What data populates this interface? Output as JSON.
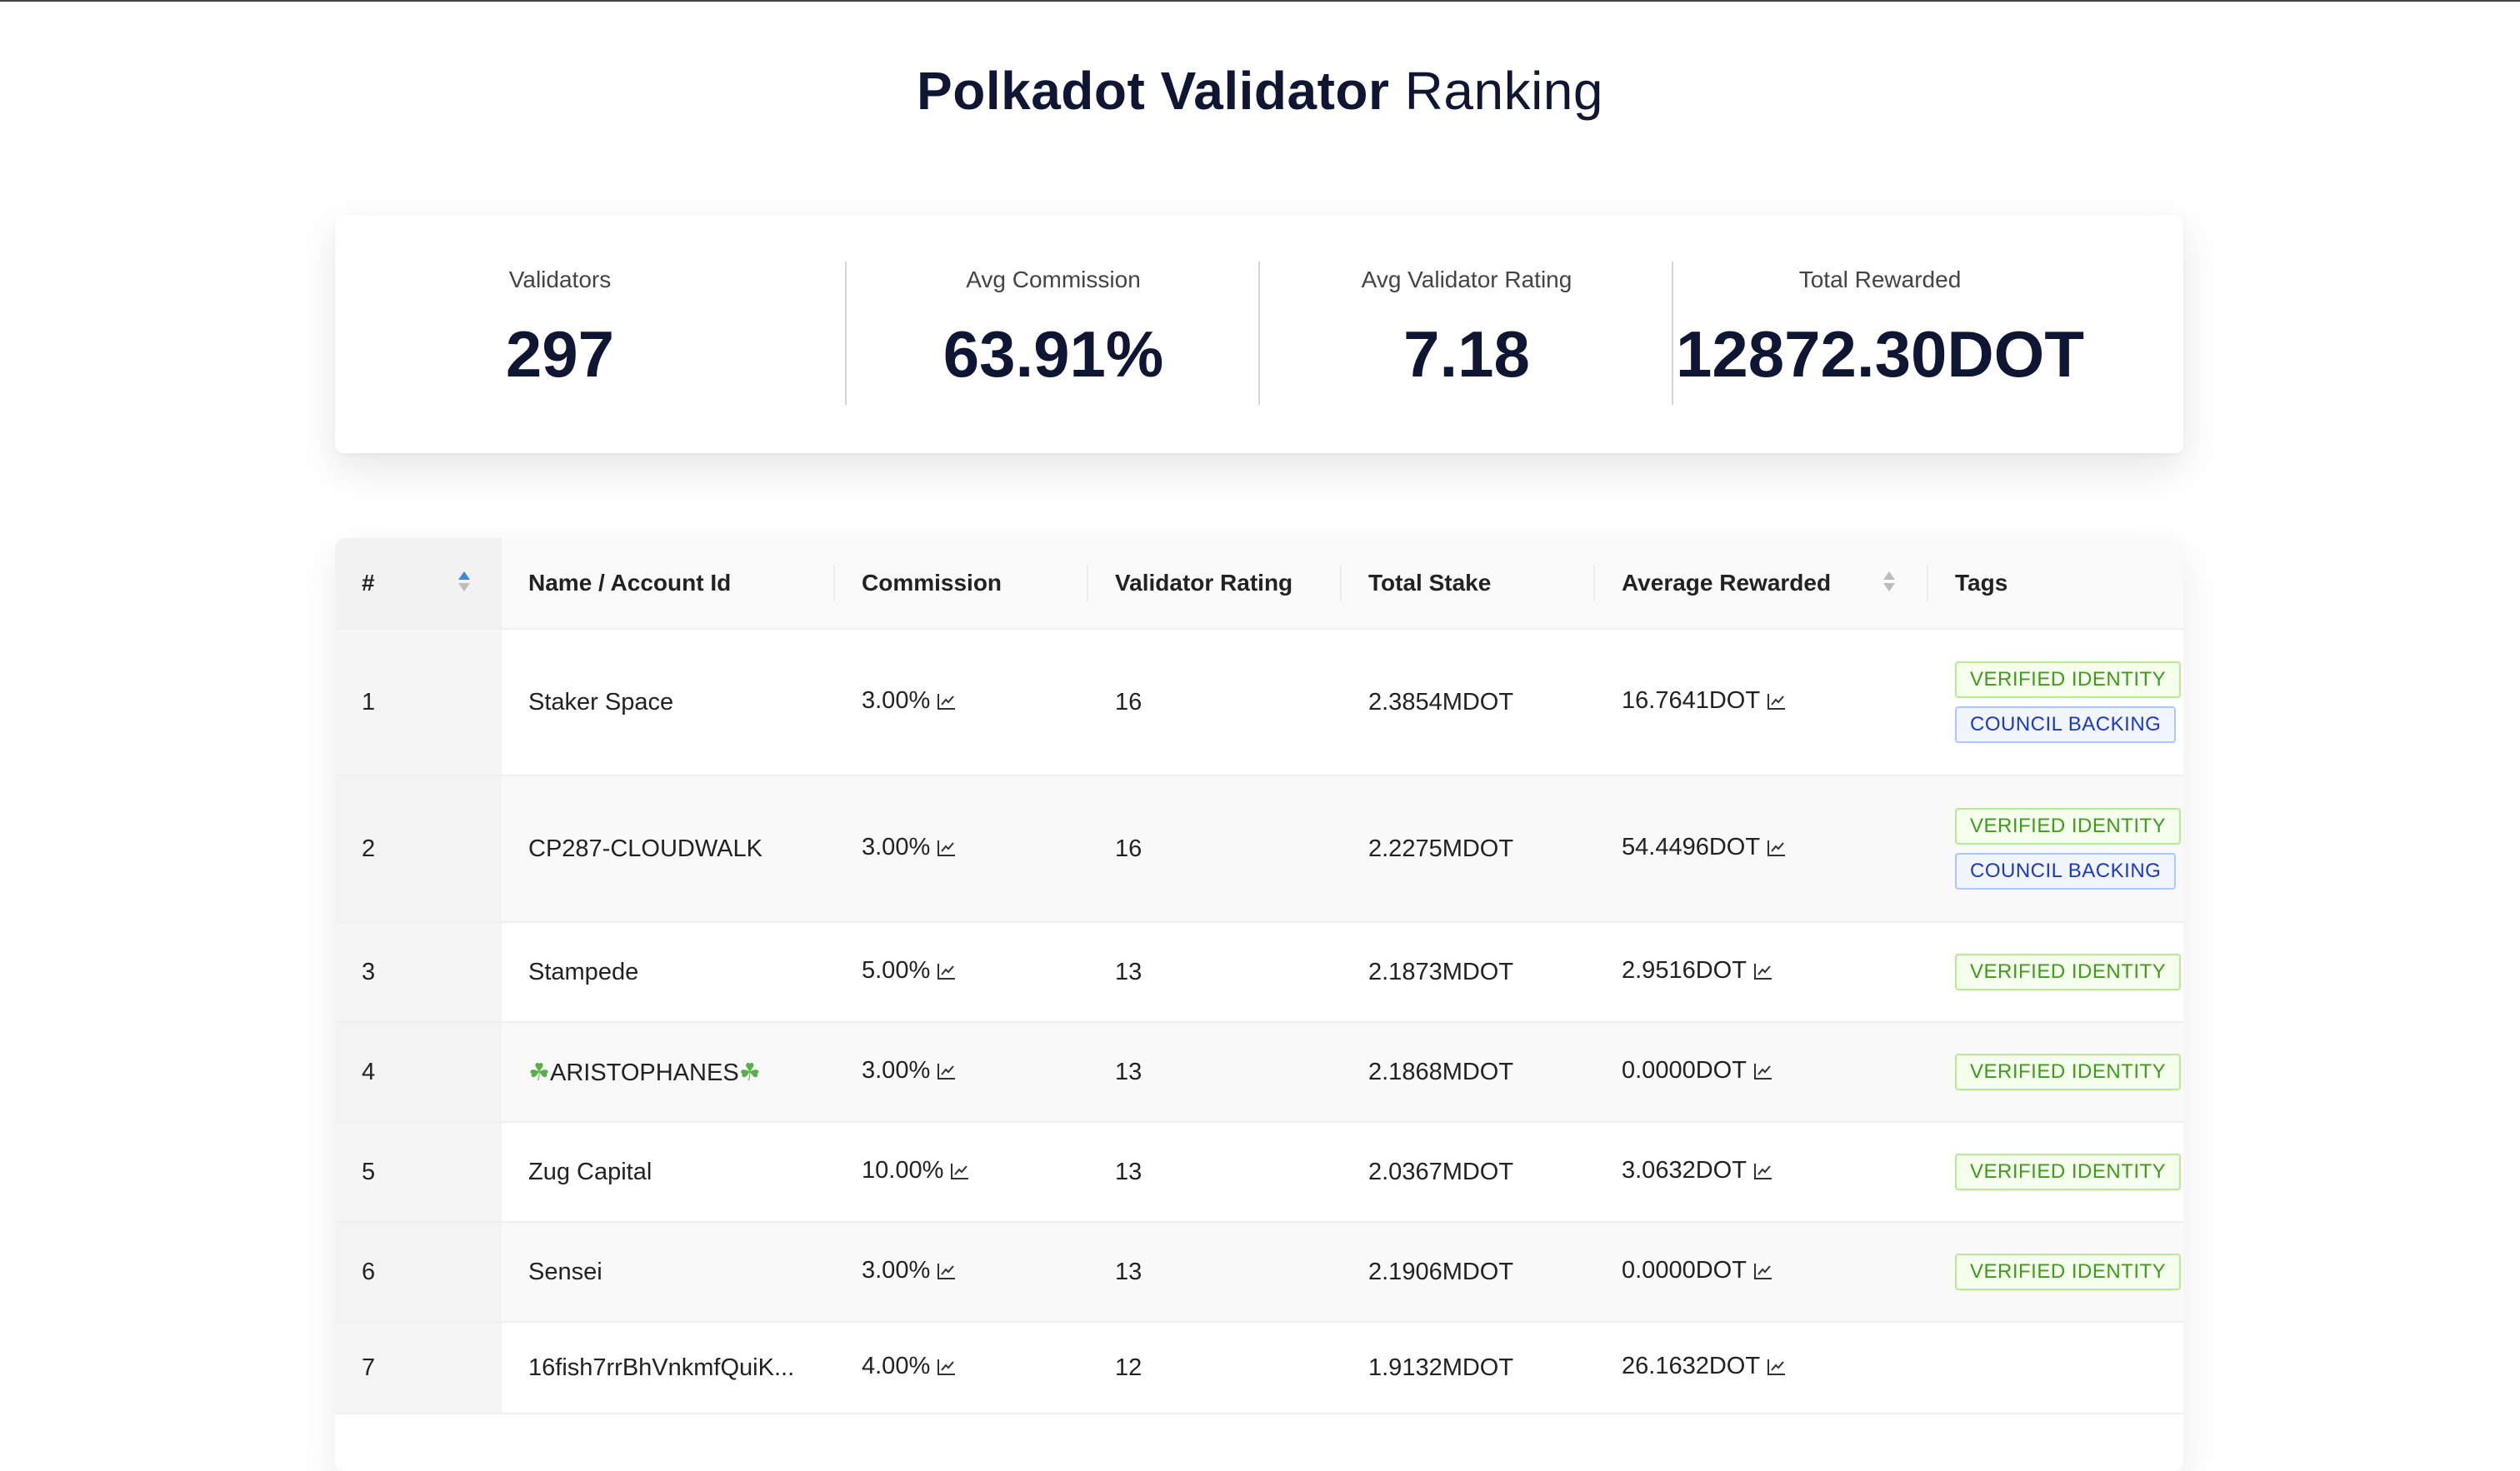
{
  "title": {
    "bold": "Polkadot Validator",
    "light": "Ranking"
  },
  "stats": [
    {
      "label": "Validators",
      "value": "297"
    },
    {
      "label": "Avg Commission",
      "value": "63.91%"
    },
    {
      "label": "Avg Validator Rating",
      "value": "7.18"
    },
    {
      "label": "Total Rewarded",
      "value": "12872.30DOT"
    }
  ],
  "table": {
    "headers": {
      "rank": "#",
      "name": "Name / Account Id",
      "commission": "Commission",
      "rating": "Validator Rating",
      "stake": "Total Stake",
      "rewarded": "Average Rewarded",
      "tags": "Tags"
    },
    "tag_labels": {
      "verified": "VERIFIED IDENTITY",
      "council": "COUNCIL BACKING"
    },
    "rows": [
      {
        "rank": "1",
        "name": "Staker Space",
        "commission": "3.00%",
        "rating": "16",
        "stake": "2.3854MDOT",
        "rewarded": "16.7641DOT",
        "tags": [
          "verified",
          "council"
        ]
      },
      {
        "rank": "2",
        "name": "CP287-CLOUDWALK",
        "commission": "3.00%",
        "rating": "16",
        "stake": "2.2275MDOT",
        "rewarded": "54.4496DOT",
        "tags": [
          "verified",
          "council"
        ]
      },
      {
        "rank": "3",
        "name": "Stampede",
        "commission": "5.00%",
        "rating": "13",
        "stake": "2.1873MDOT",
        "rewarded": "2.9516DOT",
        "tags": [
          "verified"
        ]
      },
      {
        "rank": "4",
        "name": "ARISTOPHANES",
        "name_decoration": "clover",
        "commission": "3.00%",
        "rating": "13",
        "stake": "2.1868MDOT",
        "rewarded": "0.0000DOT",
        "tags": [
          "verified"
        ]
      },
      {
        "rank": "5",
        "name": "Zug Capital",
        "commission": "10.00%",
        "rating": "13",
        "stake": "2.0367MDOT",
        "rewarded": "3.0632DOT",
        "tags": [
          "verified"
        ]
      },
      {
        "rank": "6",
        "name": "Sensei",
        "commission": "3.00%",
        "rating": "13",
        "stake": "2.1906MDOT",
        "rewarded": "0.0000DOT",
        "tags": [
          "verified"
        ]
      },
      {
        "rank": "7",
        "name": "16fish7rrBhVnkmfQuiK...",
        "commission": "4.00%",
        "rating": "12",
        "stake": "1.9132MDOT",
        "rewarded": "26.1632DOT",
        "tags": []
      }
    ]
  },
  "icons": {
    "chart": "line-chart-icon",
    "sort": "sort-icon",
    "clover": "clover-icon"
  },
  "colors": {
    "title": "#0f1633",
    "verified": "#3f9b1a",
    "council": "#1d39c4",
    "sort_active": "#3d86e8"
  }
}
